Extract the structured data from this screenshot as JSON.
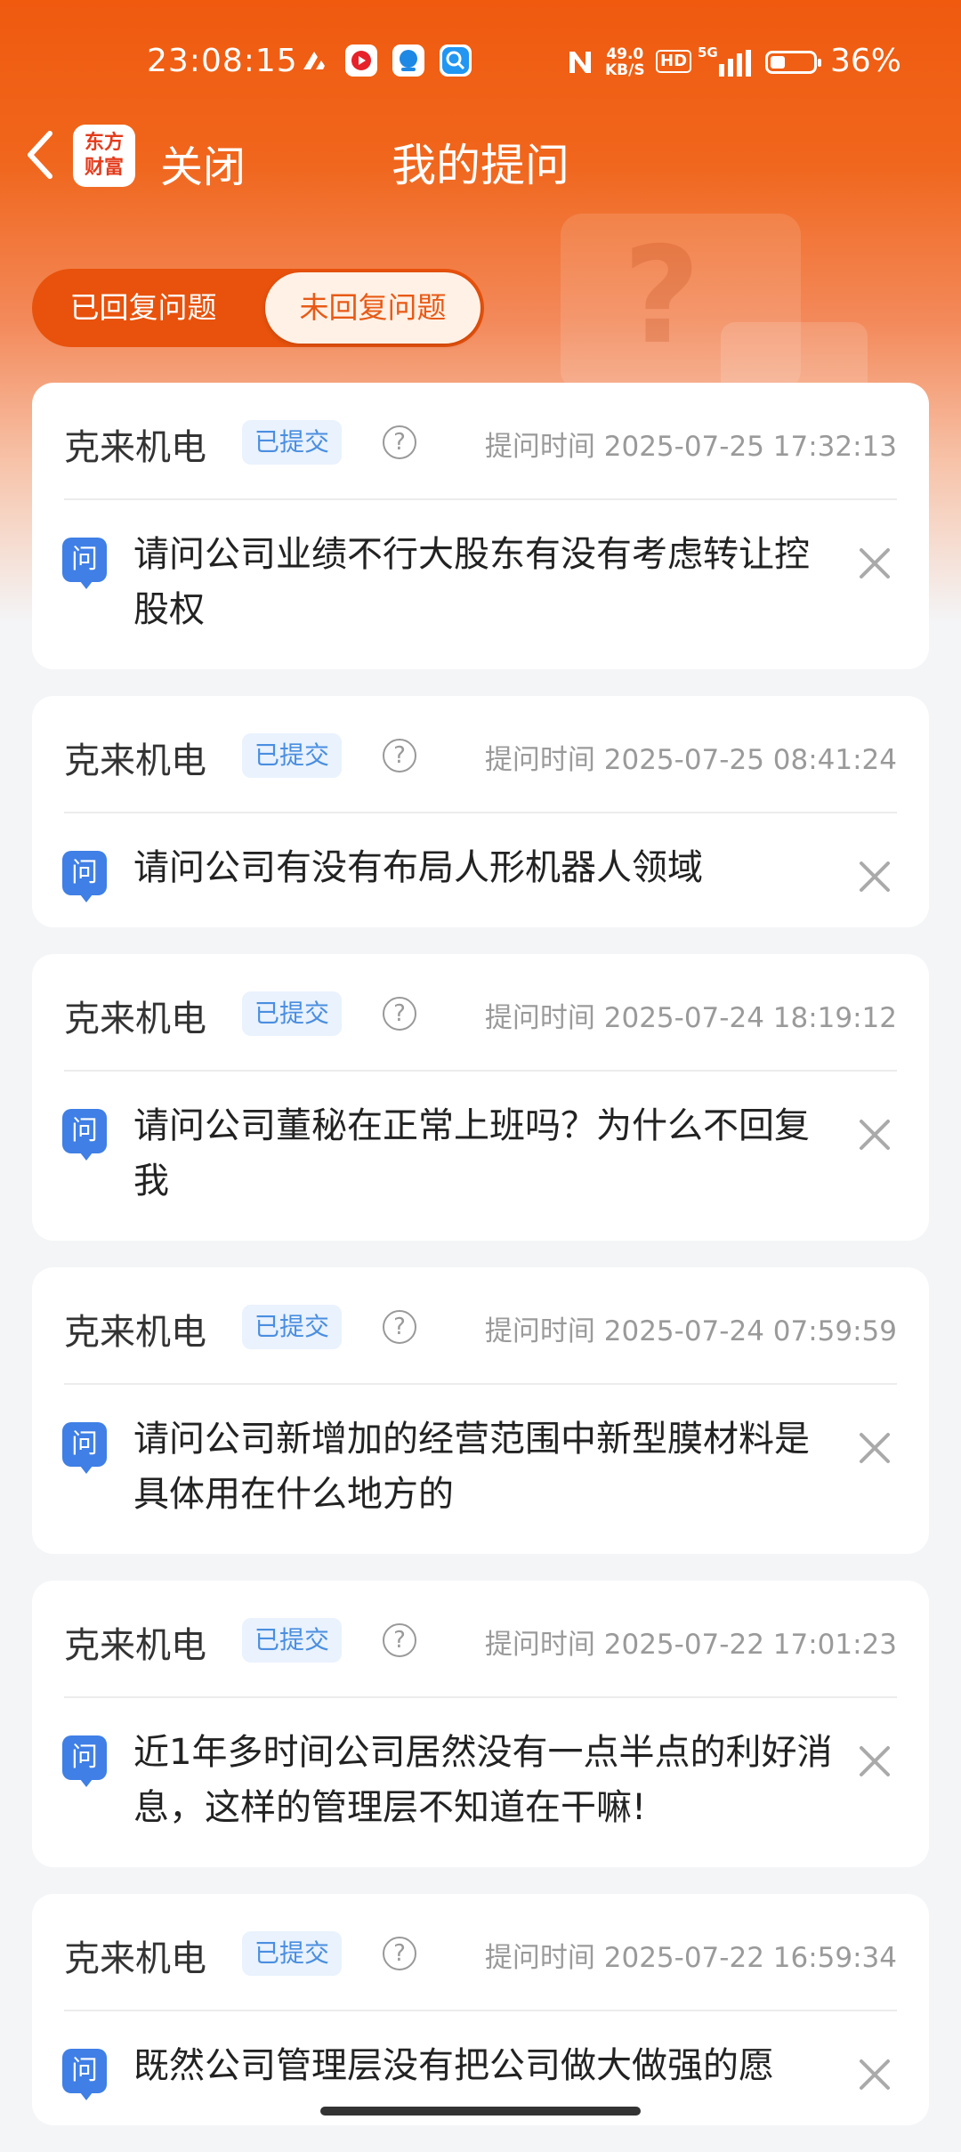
{
  "status_bar": {
    "time": "23:08:15",
    "net_speed_top": "49.0",
    "net_speed_unit": "KB/S",
    "hd": "HD",
    "signal": "5G",
    "battery_pct": "36%",
    "battery_level": 0.36
  },
  "nav": {
    "logo_line1": "东方",
    "logo_line2": "财富",
    "close_label": "关闭",
    "title": "我的提问"
  },
  "tabs": [
    {
      "label": "已回复问题",
      "active": false
    },
    {
      "label": "未回复问题",
      "active": true
    }
  ],
  "questions": [
    {
      "company": "克来机电",
      "status": "已提交",
      "time": "提问时间 2025-07-25 17:32:13",
      "text": "请问公司业绩不行大股东有没有考虑转让控股权"
    },
    {
      "company": "克来机电",
      "status": "已提交",
      "time": "提问时间 2025-07-25 08:41:24",
      "text": "请问公司有没有布局人形机器人领域"
    },
    {
      "company": "克来机电",
      "status": "已提交",
      "time": "提问时间 2025-07-24 18:19:12",
      "text": "请问公司董秘在正常上班吗？为什么不回复我"
    },
    {
      "company": "克来机电",
      "status": "已提交",
      "time": "提问时间 2025-07-24 07:59:59",
      "text": "请问公司新增加的经营范围中新型膜材料是具体用在什么地方的"
    },
    {
      "company": "克来机电",
      "status": "已提交",
      "time": "提问时间 2025-07-22 17:01:23",
      "text": "近1年多时间公司居然没有一点半点的利好消息，这样的管理层不知道在干嘛!"
    },
    {
      "company": "克来机电",
      "status": "已提交",
      "time": "提问时间 2025-07-22 16:59:34",
      "text": "既然公司管理层没有把公司做大做强的愿"
    }
  ],
  "labels": {
    "q_icon": "问",
    "help_icon": "?"
  },
  "colors": {
    "brand_orange": "#ef5a0f",
    "badge_blue": "#4a8ee0",
    "q_icon_blue": "#3f7fe6"
  }
}
